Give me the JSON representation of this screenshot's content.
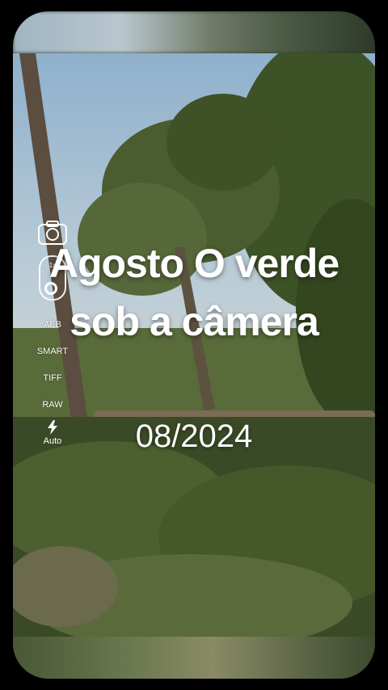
{
  "overlay": {
    "title": "Agosto O verde sob a câmera",
    "date": "08/2024"
  },
  "camera_controls": {
    "zoom_label": "1x",
    "options": [
      "AEB",
      "SMART",
      "TIFF",
      "RAW"
    ],
    "flash_label": "Auto"
  },
  "icons": {
    "camera": "camera-icon",
    "flash": "flash-icon"
  },
  "colors": {
    "background": "#000000",
    "text": "#ffffff"
  }
}
